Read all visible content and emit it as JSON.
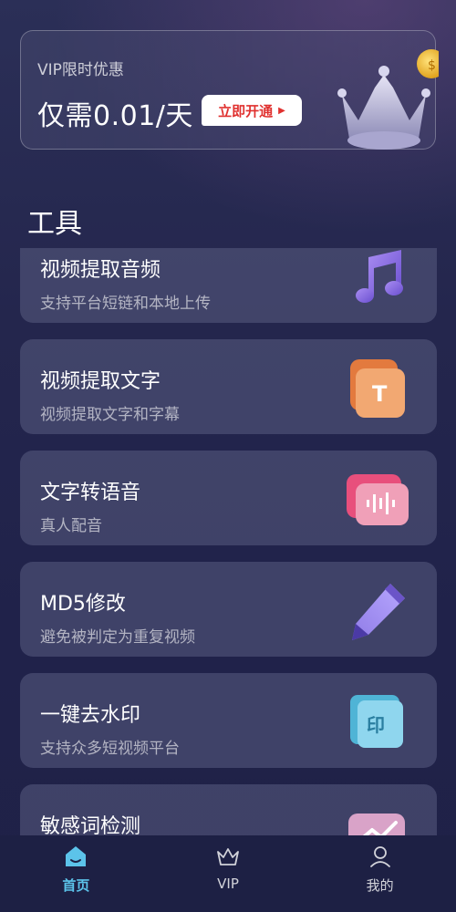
{
  "vip_banner": {
    "title": "VIP限时优惠",
    "price": "仅需0.01/天",
    "button_label": "立即开通"
  },
  "section_title": "工具",
  "tools": [
    {
      "title": "视频提取音频",
      "desc": "支持平台短链和本地上传",
      "icon": "music-note-icon"
    },
    {
      "title": "视频提取文字",
      "desc": "视频提取文字和字幕",
      "icon": "text-t-icon"
    },
    {
      "title": "文字转语音",
      "desc": "真人配音",
      "icon": "voice-wave-icon"
    },
    {
      "title": "MD5修改",
      "desc": "避免被判定为重复视频",
      "icon": "pen-icon"
    },
    {
      "title": "一键去水印",
      "desc": "支持众多短视频平台",
      "icon": "stamp-icon"
    },
    {
      "title": "敏感词检测",
      "desc": "",
      "icon": "chart-icon"
    }
  ],
  "bottom_nav": [
    {
      "label": "首页",
      "icon": "home-icon",
      "active": true
    },
    {
      "label": "VIP",
      "icon": "crown-icon",
      "active": false
    },
    {
      "label": "我的",
      "icon": "profile-icon",
      "active": false
    }
  ],
  "colors": {
    "accent": "#5cc3ea",
    "button_text": "#e0312f"
  }
}
